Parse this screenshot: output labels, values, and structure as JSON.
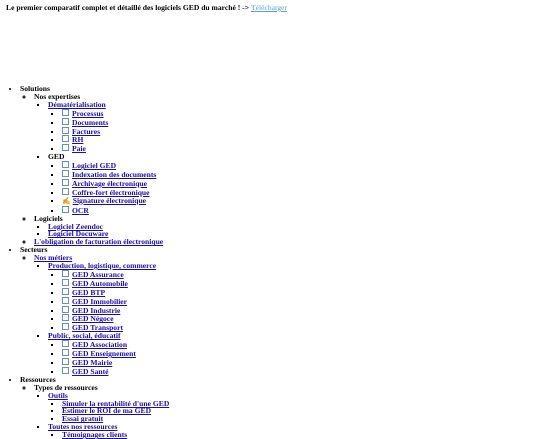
{
  "banner": {
    "text": "Le premier comparatif complet et détaillé des logiciels GED du marché ! ->",
    "link": "Télécharger"
  },
  "menu": {
    "solutions": {
      "label": "Solutions",
      "expertises": {
        "label": "Nos expertises",
        "dematerialisation": {
          "label": "Dématérialisation",
          "items": [
            "Processus",
            "Documents",
            "Factures",
            "RH",
            "Paie"
          ]
        },
        "ged": {
          "label": "GED",
          "items": [
            "Logiciel GED",
            "Indexation des documents",
            "Archivage électronique",
            "Coffre-fort électronique",
            "Signature électronique",
            "OCR"
          ]
        }
      },
      "logiciels": {
        "label": "Logiciels",
        "items": [
          "Logiciel Zeendoc",
          "Logiciel Docuware"
        ]
      },
      "facturation": "L'obligation de facturation électronique"
    },
    "secteurs": {
      "label": "Secteurs",
      "metiers": {
        "label": "Nos métiers",
        "production": {
          "label": "Production, logistique, commerce",
          "items": [
            "GED Assurance",
            "GED Automobile",
            "GED BTP",
            "GED Immobilier",
            "GED Industrie",
            "GED Négoce",
            "GED Transport"
          ]
        },
        "public": {
          "label": "Public, social, éducatif",
          "items": [
            "GED Association",
            "GED Enseignement",
            "GED Mairie",
            "GED Santé"
          ]
        }
      }
    },
    "ressources": {
      "label": "Ressources",
      "types": {
        "label": "Types de ressources",
        "outils": {
          "label": "Outils",
          "items": [
            "Simuler la rentabilité d'une GED",
            "Estimer le ROI de ma GED",
            "Essai gratuit"
          ]
        },
        "toutes": {
          "label": "Toutes nos ressources",
          "items": [
            "Témoignages clients"
          ]
        }
      }
    }
  }
}
